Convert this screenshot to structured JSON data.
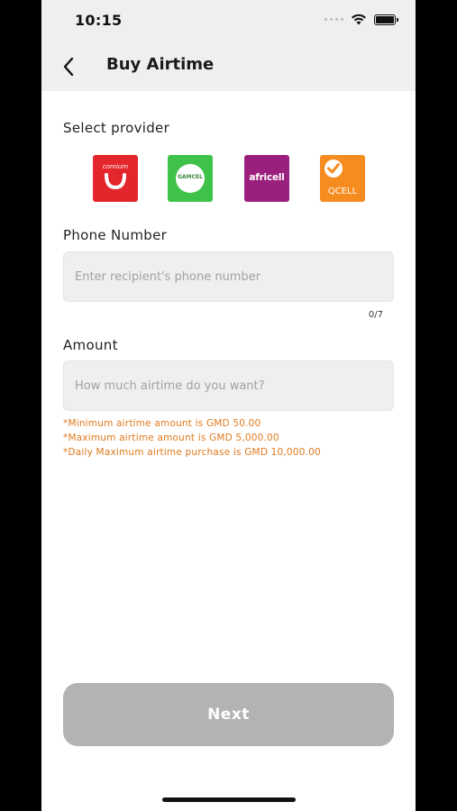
{
  "status": {
    "time": "10:15"
  },
  "header": {
    "title": "Buy Airtime"
  },
  "provider": {
    "label": "Select provider",
    "items": [
      {
        "name": "comium",
        "text": "comium"
      },
      {
        "name": "gamcel",
        "text": "GAMCEL"
      },
      {
        "name": "africell",
        "text": "africell"
      },
      {
        "name": "qcell",
        "text": "QCELL"
      }
    ]
  },
  "phone": {
    "label": "Phone Number",
    "placeholder": "Enter recipient's phone number",
    "value": "",
    "counter": "0/7"
  },
  "amount": {
    "label": "Amount",
    "placeholder": "How much airtime do you want?",
    "value": "",
    "notes": [
      "*Minimum airtime amount is GMD 50.00",
      "*Maximum airtime amount is GMD 5,000.00",
      "*Daily Maximum airtime purchase is GMD 10,000.00"
    ]
  },
  "actions": {
    "next_label": "Next"
  },
  "colors": {
    "note": "#e07a1f",
    "button_disabled": "#b3b3b3",
    "comium": "#e3262b",
    "gamcel": "#3ec24a",
    "africell": "#9b1f7d",
    "qcell": "#f68b1f"
  }
}
